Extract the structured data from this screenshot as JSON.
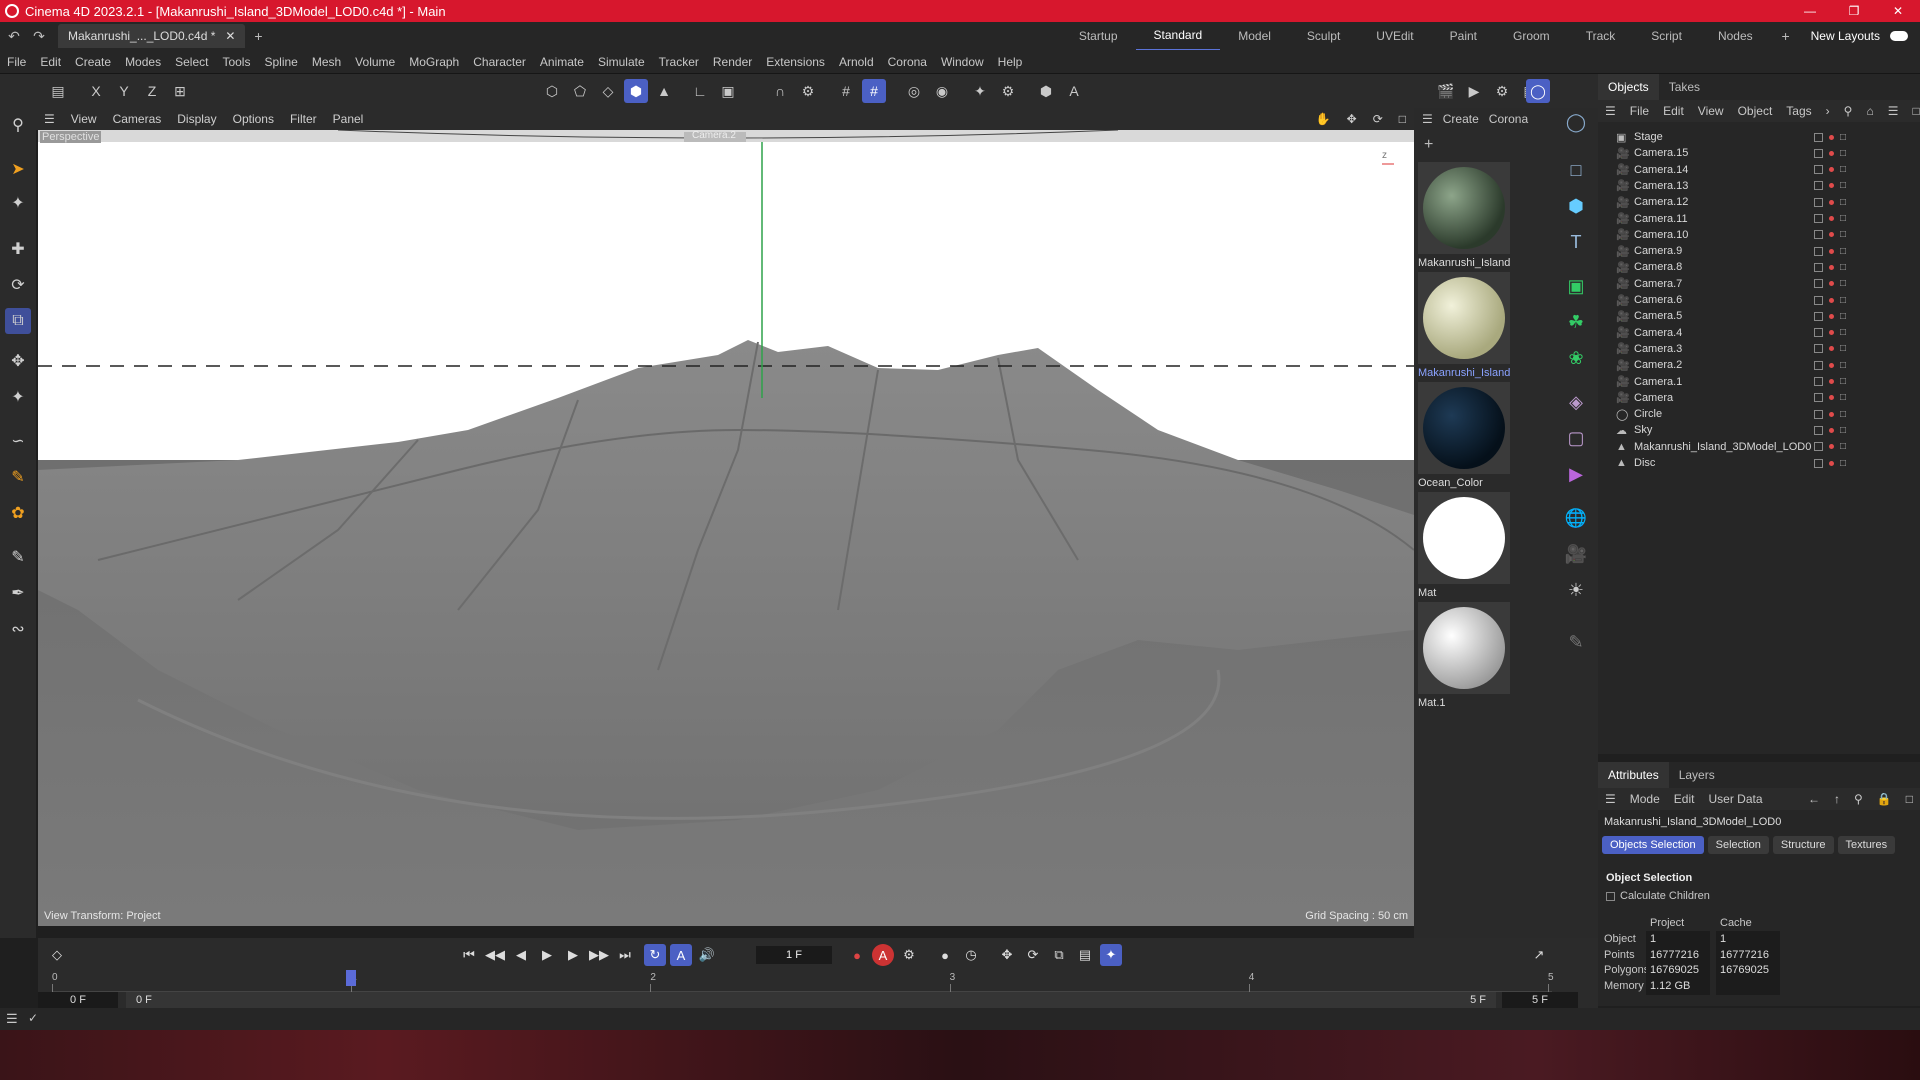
{
  "window": {
    "title": "Cinema 4D 2023.2.1 - [Makanrushi_Island_3DModel_LOD0.c4d *] - Main"
  },
  "doc_tab": {
    "label": "Makanrushi_..._LOD0.c4d *"
  },
  "layouts": [
    "Startup",
    "Standard",
    "Model",
    "Sculpt",
    "UVEdit",
    "Paint",
    "Groom",
    "Track",
    "Script",
    "Nodes"
  ],
  "new_layouts": "New Layouts",
  "menu": [
    "File",
    "Edit",
    "Create",
    "Modes",
    "Select",
    "Tools",
    "Spline",
    "Mesh",
    "Volume",
    "MoGraph",
    "Character",
    "Animate",
    "Simulate",
    "Tracker",
    "Render",
    "Extensions",
    "Arnold",
    "Corona",
    "Window",
    "Help"
  ],
  "axis_labels": {
    "x": "X",
    "y": "Y",
    "z": "Z"
  },
  "viewport": {
    "menu": [
      "View",
      "Cameras",
      "Display",
      "Options",
      "Filter",
      "Panel"
    ],
    "label": "Perspective",
    "camera_label": "Camera.2",
    "view_transform": "View Transform: Project",
    "grid_spacing": "Grid Spacing : 50 cm"
  },
  "materials": {
    "menu": [
      "Create",
      "Corona"
    ],
    "items": [
      {
        "name": "Makanrushi_Island",
        "color": "#3b4a3a"
      },
      {
        "name": "Makanrushi_Island",
        "color": "#c9c9a4"
      },
      {
        "name": "Ocean_Color",
        "color": "#0b1b2a"
      },
      {
        "name": "Mat",
        "color": "#ffffff"
      },
      {
        "name": "Mat.1",
        "color": "#cfcfcf"
      }
    ]
  },
  "objects_panel": {
    "tabs": [
      "Objects",
      "Takes"
    ],
    "menu": [
      "File",
      "Edit",
      "View",
      "Object",
      "Tags"
    ],
    "items": [
      {
        "name": "Stage",
        "icon": "stage-icon"
      },
      {
        "name": "Camera.15",
        "icon": "camera-icon"
      },
      {
        "name": "Camera.14",
        "icon": "camera-icon"
      },
      {
        "name": "Camera.13",
        "icon": "camera-icon"
      },
      {
        "name": "Camera.12",
        "icon": "camera-icon"
      },
      {
        "name": "Camera.11",
        "icon": "camera-icon"
      },
      {
        "name": "Camera.10",
        "icon": "camera-icon"
      },
      {
        "name": "Camera.9",
        "icon": "camera-icon"
      },
      {
        "name": "Camera.8",
        "icon": "camera-icon"
      },
      {
        "name": "Camera.7",
        "icon": "camera-icon"
      },
      {
        "name": "Camera.6",
        "icon": "camera-icon"
      },
      {
        "name": "Camera.5",
        "icon": "camera-icon"
      },
      {
        "name": "Camera.4",
        "icon": "camera-icon"
      },
      {
        "name": "Camera.3",
        "icon": "camera-icon"
      },
      {
        "name": "Camera.2",
        "icon": "camera-icon"
      },
      {
        "name": "Camera.1",
        "icon": "camera-icon"
      },
      {
        "name": "Camera",
        "icon": "camera-icon"
      },
      {
        "name": "Circle",
        "icon": "circle-icon"
      },
      {
        "name": "Sky",
        "icon": "sky-icon"
      },
      {
        "name": "Makanrushi_Island_3DModel_LOD0",
        "icon": "polygon-icon"
      },
      {
        "name": "Disc",
        "icon": "polygon-icon"
      }
    ]
  },
  "attributes": {
    "tabs": [
      "Attributes",
      "Layers"
    ],
    "menu": [
      "Mode",
      "Edit",
      "User Data"
    ],
    "object_name": "Makanrushi_Island_3DModel_LOD0",
    "subtabs": [
      "Objects Selection",
      "Selection",
      "Structure",
      "Textures"
    ],
    "section": "Object Selection",
    "calc_children": "Calculate Children",
    "col_project": "Project",
    "col_cache": "Cache",
    "rows": [
      {
        "label": "Object",
        "project": "1",
        "cache": "1"
      },
      {
        "label": "Points",
        "project": "16777216",
        "cache": "16777216"
      },
      {
        "label": "Polygons",
        "project": "16769025",
        "cache": "16769025"
      },
      {
        "label": "Memory",
        "project": "1.12 GB",
        "cache": ""
      }
    ]
  },
  "timeline": {
    "current_frame": "1 F",
    "start": "0 F",
    "start2": "0 F",
    "end": "5 F",
    "end2": "5 F",
    "ticks": [
      "0",
      "1",
      "2",
      "3",
      "4",
      "5"
    ],
    "playhead_fraction": 0.2
  }
}
